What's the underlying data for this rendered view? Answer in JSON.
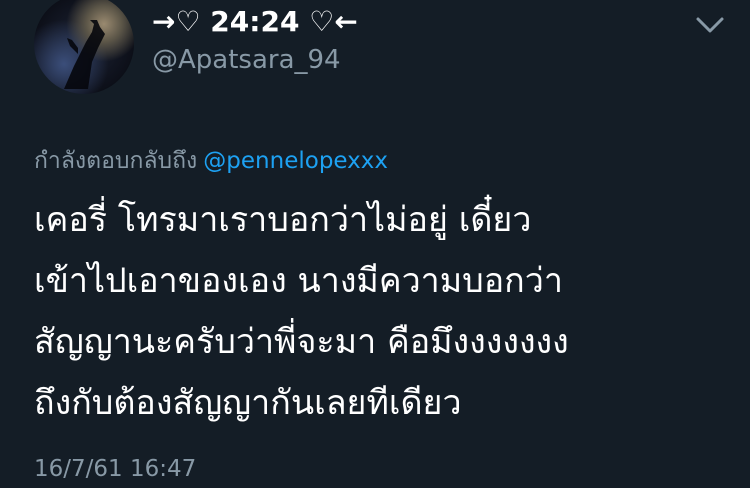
{
  "tweet": {
    "display_name": "→♡ 24:24 ♡←",
    "handle": "@Apatsara_94",
    "reply_prefix": "กำลังตอบกลับถึง",
    "reply_mention": "@pennelopexxx",
    "text_lines": [
      "เคอรี่ โทรมาเราบอกว่าไม่อยู่ เดี๋ยว",
      "เข้าไปเอาของเอง นางมีความบอกว่า",
      "สัญญานะครับว่าพี่จะมา คือมึงงงงงงง",
      "ถึงกับต้องสัญญากันเลยทีเดียว"
    ],
    "timestamp": "16/7/61 16:47"
  },
  "icons": {
    "menu": "chevron-down-icon"
  },
  "colors": {
    "background": "#141d26",
    "text": "#ffffff",
    "secondary": "#8899a6",
    "link": "#1da1f2"
  }
}
